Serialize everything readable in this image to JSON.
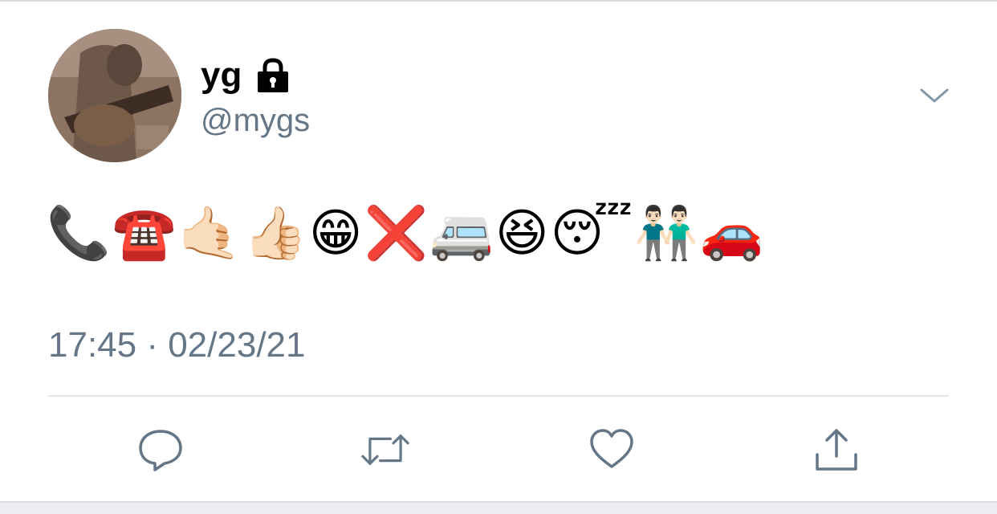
{
  "user": {
    "display_name": "yg",
    "handle": "@mygs",
    "protected_icon": "lock-icon",
    "avatar": "avatar"
  },
  "tweet": {
    "text": "📞☎️🤙🏻👍🏻😁❌🚐😆😴👬🏻🚗",
    "timestamp": "17:45 · 02/23/21"
  },
  "actions": {
    "reply_icon": "reply-icon",
    "retweet_icon": "retweet-icon",
    "like_icon": "heart-icon",
    "share_icon": "share-icon"
  },
  "menu": {
    "caret_icon": "chevron-down-icon"
  },
  "colors": {
    "secondary_text": "#657786",
    "divider": "#e1e6ea",
    "icon": "#657786"
  }
}
